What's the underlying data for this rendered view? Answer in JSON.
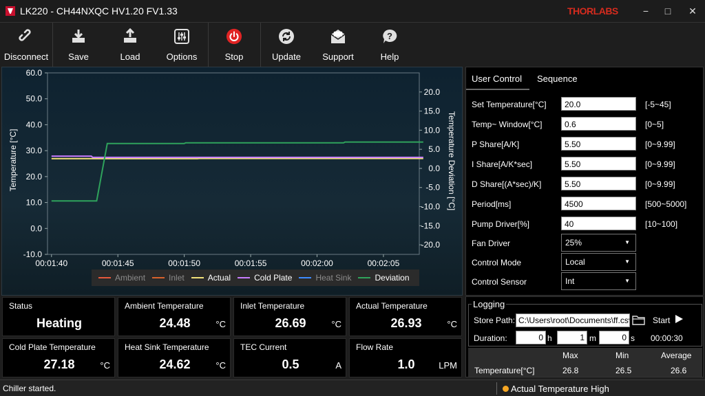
{
  "window": {
    "title": "LK220 - CH44NXQC HV1.20 FV1.33",
    "logo": "THORLABS",
    "minimize": "−",
    "maximize": "□",
    "close": "✕"
  },
  "toolbar": {
    "disconnect": "Disconnect",
    "save": "Save",
    "load": "Load",
    "options": "Options",
    "stop": "Stop",
    "update": "Update",
    "support": "Support",
    "help": "Help"
  },
  "chart_data": {
    "type": "line",
    "ylabel": "Temperature [°C]",
    "y2label": "Temperature Deviation [°C]",
    "ylim": [
      -10,
      60
    ],
    "y2lim": [
      -22.5,
      25
    ],
    "yticks": [
      "60.0",
      "50.0",
      "40.0",
      "30.0",
      "20.0",
      "10.0",
      "0.0",
      "-10.0"
    ],
    "y2ticks": [
      "20.0",
      "15.0",
      "10.0",
      "5.0",
      "0.0",
      "-5.0",
      "-10.0",
      "-15.0",
      "-20.0"
    ],
    "xticks": [
      "00:01:40",
      "00:01:45",
      "00:01:50",
      "00:01:55",
      "00:02:00",
      "00:02:05"
    ],
    "grid": false,
    "series": [
      {
        "name": "Ambient",
        "color": "#e8593c",
        "enabled": false,
        "axis": "left",
        "points": []
      },
      {
        "name": "Inlet",
        "color": "#d9622c",
        "enabled": false,
        "axis": "left",
        "points": []
      },
      {
        "name": "Actual",
        "color": "#f2e27a",
        "enabled": true,
        "axis": "left",
        "points": [
          [
            0,
            26.9
          ],
          [
            11,
            26.9
          ],
          [
            11.1,
            27.0
          ],
          [
            28,
            27.0
          ]
        ]
      },
      {
        "name": "Cold Plate",
        "color": "#c77dff",
        "enabled": true,
        "axis": "left",
        "points": [
          [
            0,
            27.9
          ],
          [
            3,
            27.9
          ],
          [
            3.1,
            27.4
          ],
          [
            28,
            27.4
          ]
        ]
      },
      {
        "name": "Heat Sink",
        "color": "#3d8bff",
        "enabled": false,
        "axis": "left",
        "points": []
      },
      {
        "name": "Deviation",
        "color": "#2fa35c",
        "enabled": true,
        "axis": "right",
        "points": [
          [
            0,
            -8.5
          ],
          [
            3.4,
            -8.5
          ],
          [
            4.2,
            6.5
          ],
          [
            10,
            6.5
          ],
          [
            10.1,
            6.7
          ],
          [
            22,
            6.7
          ],
          [
            22.1,
            6.9
          ],
          [
            28,
            6.9
          ]
        ]
      }
    ],
    "xrange": [
      -0.3,
      27.7
    ]
  },
  "controls": {
    "tab_user": "User Control",
    "tab_sequence": "Sequence",
    "params": [
      {
        "label": "Set Temperature[°C]",
        "value": "20.0",
        "range": "[-5~45]"
      },
      {
        "label": "Temp~ Window[°C]",
        "value": "0.6",
        "range": "[0~5]"
      },
      {
        "label": "P Share[A/K]",
        "value": "5.50",
        "range": "[0~9.99]"
      },
      {
        "label": "I Share[A/K*sec]",
        "value": "5.50",
        "range": "[0~9.99]"
      },
      {
        "label": "D Share[(A*sec)/K]",
        "value": "5.50",
        "range": "[0~9.99]"
      },
      {
        "label": "Period[ms]",
        "value": "4500",
        "range": "[500~5000]"
      },
      {
        "label": "Pump Driver[%]",
        "value": "40",
        "range": "[10~100]"
      }
    ],
    "selects": [
      {
        "label": "Fan Driver",
        "value": "25%"
      },
      {
        "label": "Control Mode",
        "value": "Local"
      },
      {
        "label": "Control Sensor",
        "value": "Int"
      }
    ]
  },
  "tiles": [
    {
      "label": "Status",
      "value": "Heating",
      "unit": ""
    },
    {
      "label": "Ambient Temperature",
      "value": "24.48",
      "unit": "°C"
    },
    {
      "label": "Inlet Temperature",
      "value": "26.69",
      "unit": "°C"
    },
    {
      "label": "Actual Temperature",
      "value": "26.93",
      "unit": "°C"
    },
    {
      "label": "Cold Plate Temperature",
      "value": "27.18",
      "unit": "°C"
    },
    {
      "label": "Heat Sink Temperature",
      "value": "24.62",
      "unit": "°C"
    },
    {
      "label": "TEC Current",
      "value": "0.5",
      "unit": "A"
    },
    {
      "label": "Flow Rate",
      "value": "1.0",
      "unit": "LPM"
    }
  ],
  "logging": {
    "title": "Logging",
    "store_path_label": "Store Path:",
    "store_path": "C:\\Users\\root\\Documents\\ff.csv",
    "start": "Start",
    "duration_label": "Duration:",
    "hours": "0",
    "h": "h",
    "minutes": "1",
    "m": "m",
    "seconds": "0",
    "s": "s",
    "elapsed": "00:00:30",
    "stats_header": {
      "max": "Max",
      "min": "Min",
      "avg": "Average"
    },
    "stats_row": {
      "label": "Temperature[°C]",
      "max": "26.8",
      "min": "26.5",
      "avg": "26.6"
    }
  },
  "statusbar": {
    "message": "Chiller started.",
    "alarm": "Actual Temperature High"
  }
}
